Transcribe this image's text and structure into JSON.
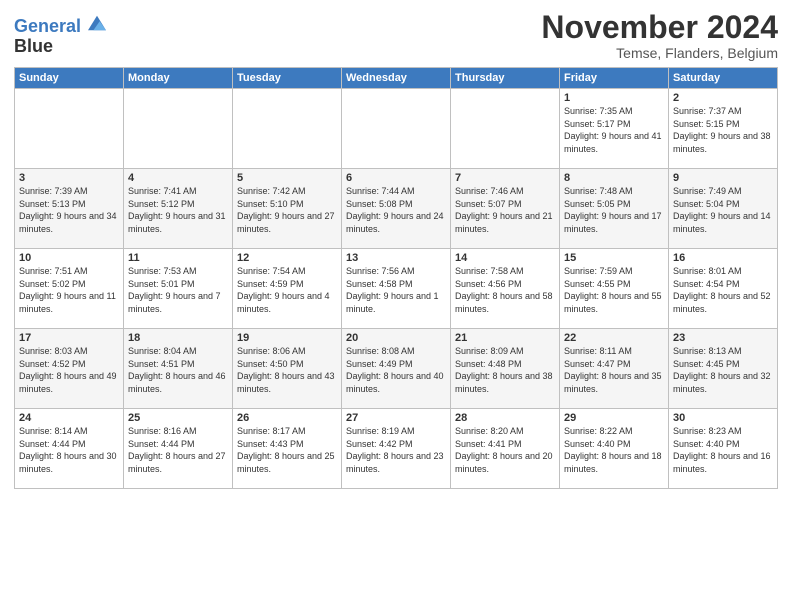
{
  "header": {
    "logo_line1": "General",
    "logo_line2": "Blue",
    "title": "November 2024",
    "subtitle": "Temse, Flanders, Belgium"
  },
  "weekdays": [
    "Sunday",
    "Monday",
    "Tuesday",
    "Wednesday",
    "Thursday",
    "Friday",
    "Saturday"
  ],
  "weeks": [
    [
      {
        "day": "",
        "info": ""
      },
      {
        "day": "",
        "info": ""
      },
      {
        "day": "",
        "info": ""
      },
      {
        "day": "",
        "info": ""
      },
      {
        "day": "",
        "info": ""
      },
      {
        "day": "1",
        "info": "Sunrise: 7:35 AM\nSunset: 5:17 PM\nDaylight: 9 hours and 41 minutes."
      },
      {
        "day": "2",
        "info": "Sunrise: 7:37 AM\nSunset: 5:15 PM\nDaylight: 9 hours and 38 minutes."
      }
    ],
    [
      {
        "day": "3",
        "info": "Sunrise: 7:39 AM\nSunset: 5:13 PM\nDaylight: 9 hours and 34 minutes."
      },
      {
        "day": "4",
        "info": "Sunrise: 7:41 AM\nSunset: 5:12 PM\nDaylight: 9 hours and 31 minutes."
      },
      {
        "day": "5",
        "info": "Sunrise: 7:42 AM\nSunset: 5:10 PM\nDaylight: 9 hours and 27 minutes."
      },
      {
        "day": "6",
        "info": "Sunrise: 7:44 AM\nSunset: 5:08 PM\nDaylight: 9 hours and 24 minutes."
      },
      {
        "day": "7",
        "info": "Sunrise: 7:46 AM\nSunset: 5:07 PM\nDaylight: 9 hours and 21 minutes."
      },
      {
        "day": "8",
        "info": "Sunrise: 7:48 AM\nSunset: 5:05 PM\nDaylight: 9 hours and 17 minutes."
      },
      {
        "day": "9",
        "info": "Sunrise: 7:49 AM\nSunset: 5:04 PM\nDaylight: 9 hours and 14 minutes."
      }
    ],
    [
      {
        "day": "10",
        "info": "Sunrise: 7:51 AM\nSunset: 5:02 PM\nDaylight: 9 hours and 11 minutes."
      },
      {
        "day": "11",
        "info": "Sunrise: 7:53 AM\nSunset: 5:01 PM\nDaylight: 9 hours and 7 minutes."
      },
      {
        "day": "12",
        "info": "Sunrise: 7:54 AM\nSunset: 4:59 PM\nDaylight: 9 hours and 4 minutes."
      },
      {
        "day": "13",
        "info": "Sunrise: 7:56 AM\nSunset: 4:58 PM\nDaylight: 9 hours and 1 minute."
      },
      {
        "day": "14",
        "info": "Sunrise: 7:58 AM\nSunset: 4:56 PM\nDaylight: 8 hours and 58 minutes."
      },
      {
        "day": "15",
        "info": "Sunrise: 7:59 AM\nSunset: 4:55 PM\nDaylight: 8 hours and 55 minutes."
      },
      {
        "day": "16",
        "info": "Sunrise: 8:01 AM\nSunset: 4:54 PM\nDaylight: 8 hours and 52 minutes."
      }
    ],
    [
      {
        "day": "17",
        "info": "Sunrise: 8:03 AM\nSunset: 4:52 PM\nDaylight: 8 hours and 49 minutes."
      },
      {
        "day": "18",
        "info": "Sunrise: 8:04 AM\nSunset: 4:51 PM\nDaylight: 8 hours and 46 minutes."
      },
      {
        "day": "19",
        "info": "Sunrise: 8:06 AM\nSunset: 4:50 PM\nDaylight: 8 hours and 43 minutes."
      },
      {
        "day": "20",
        "info": "Sunrise: 8:08 AM\nSunset: 4:49 PM\nDaylight: 8 hours and 40 minutes."
      },
      {
        "day": "21",
        "info": "Sunrise: 8:09 AM\nSunset: 4:48 PM\nDaylight: 8 hours and 38 minutes."
      },
      {
        "day": "22",
        "info": "Sunrise: 8:11 AM\nSunset: 4:47 PM\nDaylight: 8 hours and 35 minutes."
      },
      {
        "day": "23",
        "info": "Sunrise: 8:13 AM\nSunset: 4:45 PM\nDaylight: 8 hours and 32 minutes."
      }
    ],
    [
      {
        "day": "24",
        "info": "Sunrise: 8:14 AM\nSunset: 4:44 PM\nDaylight: 8 hours and 30 minutes."
      },
      {
        "day": "25",
        "info": "Sunrise: 8:16 AM\nSunset: 4:44 PM\nDaylight: 8 hours and 27 minutes."
      },
      {
        "day": "26",
        "info": "Sunrise: 8:17 AM\nSunset: 4:43 PM\nDaylight: 8 hours and 25 minutes."
      },
      {
        "day": "27",
        "info": "Sunrise: 8:19 AM\nSunset: 4:42 PM\nDaylight: 8 hours and 23 minutes."
      },
      {
        "day": "28",
        "info": "Sunrise: 8:20 AM\nSunset: 4:41 PM\nDaylight: 8 hours and 20 minutes."
      },
      {
        "day": "29",
        "info": "Sunrise: 8:22 AM\nSunset: 4:40 PM\nDaylight: 8 hours and 18 minutes."
      },
      {
        "day": "30",
        "info": "Sunrise: 8:23 AM\nSunset: 4:40 PM\nDaylight: 8 hours and 16 minutes."
      }
    ]
  ]
}
